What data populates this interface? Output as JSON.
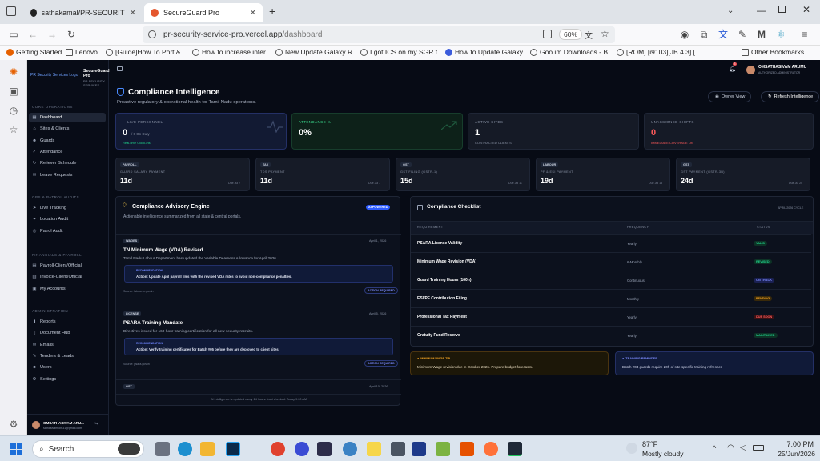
{
  "browser": {
    "tabs": [
      {
        "title": "sathakamal/PR-SECURITY-SERV"
      },
      {
        "title": "SecureGuard Pro"
      }
    ],
    "url_host": "pr-security-service-pro.vercel.app",
    "url_path": "/dashboard",
    "zoom": "60%",
    "bookmarks": [
      "Getting Started",
      "Lenovo",
      "[Guide]How To Port & ...",
      "How to increase inter...",
      "New Update Galaxy R ...",
      "I got ICS on my SGR t...",
      "How to Update Galaxy...",
      "Goo.im Downloads - B...",
      "[ROM] [i9103][JB 4.3] [..."
    ],
    "other_bookmarks": "Other Bookmarks"
  },
  "sidebar": {
    "brand_link": "PR Security Services Logo",
    "brand_name": "SecureGuard Pro",
    "brand_sub": "PR SECURITY SERVICES",
    "sections": [
      {
        "title": "CORE OPERATIONS",
        "items": [
          "Dashboard",
          "Sites & Clients",
          "Guards",
          "Attendance",
          "Reliever Schedule",
          "Leave Requests"
        ]
      },
      {
        "title": "GPS & PATROL AUDITS",
        "items": [
          "Live Tracking",
          "Location Audit",
          "Patrol Audit"
        ]
      },
      {
        "title": "FINANCIALS & PAYROLL",
        "items": [
          "Payroll-Client/Official",
          "Invoice-Client/Official",
          "My Accounts"
        ]
      },
      {
        "title": "ADMINISTRATION",
        "items": [
          "Reports",
          "Document Hub",
          "Emails",
          "Tenders & Leads",
          "Users",
          "Settings"
        ]
      }
    ],
    "user_name": "OMSATHASIVAM ARU...",
    "user_email": "sathasivam.om31@gmail.com"
  },
  "header": {
    "notif_count": "3",
    "user_name": "OMSATHASIVAM ARUMU",
    "user_role": "AUTHORIZED ADMINISTRATOR"
  },
  "page": {
    "title": "Compliance Intelligence",
    "subtitle": "Proactive regulatory & operational health for Tamil Nadu operations.",
    "owner_view": "Owner View",
    "refresh": "Refresh Intelligence"
  },
  "stats": [
    {
      "label": "LIVE PERSONNEL",
      "value": "0",
      "aside": "/ 0 On Duty",
      "sub": "Real-time Clock-ins"
    },
    {
      "label": "ATTENDANCE %",
      "value": "0%",
      "aside": "",
      "sub": ""
    },
    {
      "label": "ACTIVE SITES",
      "value": "1",
      "aside": "",
      "sub": "CONTRACTED CLIENTS"
    },
    {
      "label": "UNASSIGNED SHIFTS",
      "value": "0",
      "aside": "",
      "sub": "IMMEDIATE COVERAGE ON"
    }
  ],
  "deadlines": [
    {
      "tag": "PAYROLL",
      "label": "GUARD SALARY PAYMENT",
      "value": "11d",
      "due": "Due Jul 7"
    },
    {
      "tag": "TAX",
      "label": "TDS PAYMENT",
      "value": "11d",
      "due": "Due Jul 7"
    },
    {
      "tag": "GST",
      "label": "GST FILING (GSTR-1)",
      "value": "15d",
      "due": "Due Jul 11"
    },
    {
      "tag": "LABOUR",
      "label": "PF & ESI PAYMENT",
      "value": "19d",
      "due": "Due Jul 15"
    },
    {
      "tag": "GST",
      "label": "GST PAYMENT (GSTR-3B)",
      "value": "24d",
      "due": "Due Jul 20"
    }
  ],
  "advisory": {
    "title": "Compliance Advisory Engine",
    "badge": "AI POWERED",
    "subtitle": "Actionable intelligence summarized from all state & central portals.",
    "items": [
      {
        "tag": "WAGES",
        "date": "April 1, 2026",
        "title": "TN Minimum Wage (VDA) Revised",
        "desc": "Tamil Nadu Labour Department has updated the Variable Dearness Allowance for April 2026.",
        "rec_label": "RECOMMENDATION",
        "rec": "Action: Update April payroll files with the revised VDA rates to avoid non-compliance penalties.",
        "source": "Source: labour.tn.gov.in",
        "action": "ACTION REQUIRED"
      },
      {
        "tag": "LICENSE",
        "date": "April 5, 2026",
        "title": "PSARA Training Mandate",
        "desc": "Directives issued for 160-hour training certification for all new security recruits.",
        "rec_label": "RECOMMENDATION",
        "rec": "Action: Verify training certificates for Batch #05 before they are deployed to client sites.",
        "source": "Source: psara.gov.in",
        "action": "ACTION REQUIRED"
      },
      {
        "tag": "GST",
        "date": "April 10, 2026",
        "title": "",
        "desc": "",
        "rec_label": "",
        "rec": "",
        "source": "",
        "action": ""
      }
    ],
    "footer": "AI intelligence is updated every 24 hours. Last checked: Today 9:00 AM"
  },
  "checklist": {
    "title": "Compliance Checklist",
    "cycle": "APRIL 2026 CYCLE",
    "headers": [
      "REQUIREMENT",
      "FREQUENCY",
      "STATUS"
    ],
    "rows": [
      {
        "req": "PSARA License Validity",
        "freq": "Yearly",
        "status": "VALID",
        "color": "#1fd08a",
        "bg": "#0d3326"
      },
      {
        "req": "Minimum Wage Revision (VDA)",
        "freq": "6-Monthly",
        "status": "REVISED",
        "color": "#1fd08a",
        "bg": "#0d3326"
      },
      {
        "req": "Guard Training Hours (160h)",
        "freq": "Continuous",
        "status": "ON TRACK",
        "color": "#7d8cff",
        "bg": "#1b2153"
      },
      {
        "req": "ESI/PF Contribution Filing",
        "freq": "Monthly",
        "status": "PENDING",
        "color": "#f5a524",
        "bg": "#3a2a0a"
      },
      {
        "req": "Professional Tax Payment",
        "freq": "Yearly",
        "status": "DUE SOON",
        "color": "#ff5a5a",
        "bg": "#3b1114"
      },
      {
        "req": "Gratuity Fund Reserve",
        "freq": "Yearly",
        "status": "MAINTAINED",
        "color": "#1fd08a",
        "bg": "#0d3326"
      }
    ],
    "tips": [
      {
        "label": "MINIMUM WAGE TIP",
        "text": "Minimum Wage revision due in October 2026. Prepare budget forecasts."
      },
      {
        "label": "TRAINING REMINDER",
        "text": "Batch #04 guards require 20h of site-specific training refresher."
      }
    ]
  },
  "taskbar": {
    "search": "Search",
    "weather_temp": "87°F",
    "weather_desc": "Mostly cloudy",
    "time": "7:00 PM",
    "date": "25/Jun/2026"
  }
}
